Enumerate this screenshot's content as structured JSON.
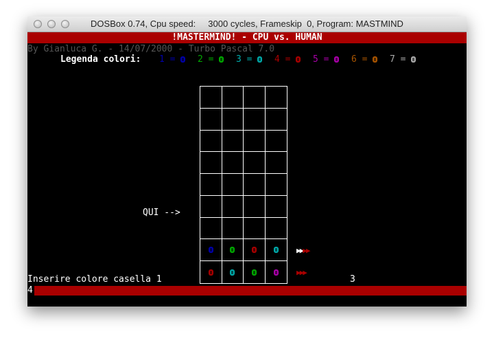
{
  "window": {
    "title": "DOSBox 0.74, Cpu speed:     3000 cycles, Frameskip  0, Program: MASTMIND"
  },
  "header": {
    "text": "!MASTERMIND! - CPU vs. HUMAN"
  },
  "credits": {
    "text": "By Gianluca G. - 14/07/2000 - Turbo Pascal 7.0"
  },
  "legend": {
    "label": "Legenda colori:",
    "items": [
      {
        "label": "1 =",
        "color": "#0000aa"
      },
      {
        "label": "2 =",
        "color": "#00aa00"
      },
      {
        "label": "3 =",
        "color": "#00aaaa"
      },
      {
        "label": "4 =",
        "color": "#aa0000"
      },
      {
        "label": "5 =",
        "color": "#aa00aa"
      },
      {
        "label": "6 =",
        "color": "#aa5500"
      },
      {
        "label": "7 =",
        "color": "#aaaaaa"
      }
    ]
  },
  "board": {
    "pointer_label": "QUI -->",
    "rows": [
      {
        "pegs": [
          null,
          null,
          null,
          null
        ]
      },
      {
        "pegs": [
          null,
          null,
          null,
          null
        ]
      },
      {
        "pegs": [
          null,
          null,
          null,
          null
        ]
      },
      {
        "pegs": [
          null,
          null,
          null,
          null
        ]
      },
      {
        "pegs": [
          null,
          null,
          null,
          null
        ]
      },
      {
        "pegs": [
          null,
          null,
          null,
          null
        ]
      },
      {
        "pegs": [
          null,
          null,
          null,
          null
        ]
      },
      {
        "pegs": [
          "#0000aa",
          "#00aa00",
          "#aa0000",
          "#00aaaa"
        ],
        "feedback": [
          "#ffffff",
          "#ffffff",
          "#aa0000",
          "#aa0000"
        ]
      },
      {
        "pegs": [
          "#aa0000",
          "#00aaaa",
          "#00aa00",
          "#aa00aa"
        ],
        "feedback": [
          "#aa0000",
          "#aa0000",
          "#aa0000"
        ]
      }
    ]
  },
  "status": {
    "prompt": "Inserire colore casella 1",
    "value": "3",
    "input": "4"
  }
}
